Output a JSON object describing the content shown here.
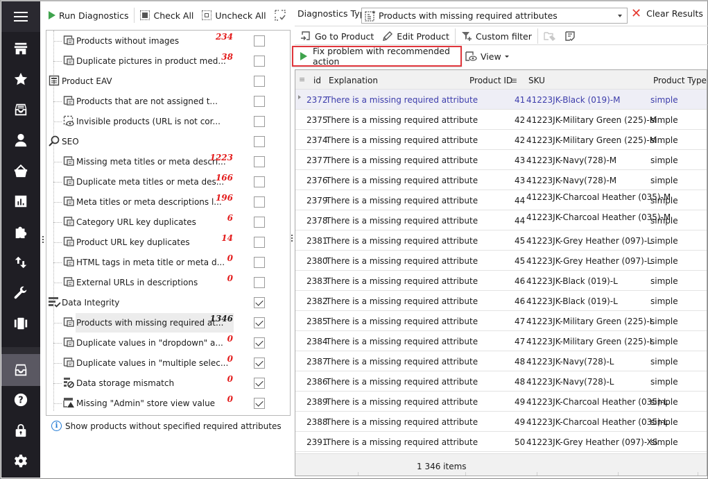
{
  "sidebar": {
    "items": [
      {
        "name": "menu",
        "icon": "hamburger-icon"
      },
      {
        "name": "store",
        "icon": "store-icon"
      },
      {
        "name": "favorites",
        "icon": "star-icon"
      },
      {
        "name": "products",
        "icon": "archive-box-icon"
      },
      {
        "name": "customers",
        "icon": "user-icon"
      },
      {
        "name": "orders",
        "icon": "basket-icon"
      },
      {
        "name": "reports",
        "icon": "bar-chart-icon"
      },
      {
        "name": "addons",
        "icon": "puzzle-icon"
      },
      {
        "name": "import-export",
        "icon": "arrows-up-down-icon"
      },
      {
        "name": "tools",
        "icon": "wrench-icon"
      },
      {
        "name": "carousel",
        "icon": "carousel-icon"
      },
      {
        "name": "store-diagnostics",
        "icon": "archive-box-icon",
        "active": true
      },
      {
        "name": "help",
        "icon": "help-icon"
      },
      {
        "name": "security",
        "icon": "lock-icon"
      },
      {
        "name": "settings",
        "icon": "gear-icon"
      }
    ]
  },
  "left_toolbar": {
    "run_diagnostics": "Run Diagnostics",
    "check_all": "Check All",
    "uncheck_all": "Uncheck All"
  },
  "tree": {
    "rows": [
      {
        "label": "Products without images",
        "count": "234",
        "checked": false,
        "level": 1,
        "icon": "no-image-icon"
      },
      {
        "label": "Duplicate pictures in product med...",
        "count": "38",
        "checked": false,
        "level": 1,
        "icon": "duplicate-image-icon"
      },
      {
        "label": "Product  EAV",
        "count": "",
        "checked": false,
        "level": 0,
        "icon": "table-icon"
      },
      {
        "label": "Products that are not assigned t...",
        "count": "",
        "checked": false,
        "level": 1,
        "icon": "unassigned-icon"
      },
      {
        "label": "Invisible products (URL is not cor...",
        "count": "",
        "checked": false,
        "level": 1,
        "icon": "invisible-icon"
      },
      {
        "label": "SEO",
        "count": "",
        "checked": false,
        "level": 0,
        "icon": "search-icon"
      },
      {
        "label": "Missing meta titles or meta descri...",
        "count": "1223",
        "checked": false,
        "level": 1,
        "icon": "missing-meta-icon"
      },
      {
        "label": "Duplicate meta titles or meta des...",
        "count": "166",
        "checked": false,
        "level": 1,
        "icon": "duplicate-meta-icon"
      },
      {
        "label": "Meta titles or meta descriptions l...",
        "count": "196",
        "checked": false,
        "level": 1,
        "icon": "meta-length-icon"
      },
      {
        "label": "Category URL key duplicates",
        "count": "6",
        "checked": false,
        "level": 1,
        "icon": "url-key-icon"
      },
      {
        "label": "Product URL key duplicates",
        "count": "14",
        "checked": false,
        "level": 1,
        "icon": "url-key-icon"
      },
      {
        "label": "HTML tags in meta title or meta d...",
        "count": "0",
        "checked": false,
        "level": 1,
        "icon": "html-tags-icon"
      },
      {
        "label": "External URLs in descriptions",
        "count": "0",
        "checked": false,
        "level": 1,
        "icon": "external-url-icon"
      },
      {
        "label": "Data Integrity",
        "count": "",
        "checked": true,
        "level": 0,
        "icon": "data-integrity-icon"
      },
      {
        "label": "Products with missing required at...",
        "count": "1346",
        "checked": true,
        "level": 1,
        "icon": "required-attr-icon",
        "selected": true
      },
      {
        "label": "Duplicate values in \"dropdown\" a...",
        "count": "0",
        "checked": true,
        "level": 1,
        "icon": "dropdown-dup-icon"
      },
      {
        "label": "Duplicate values in \"multiple selec...",
        "count": "0",
        "checked": true,
        "level": 1,
        "icon": "multiselect-dup-icon"
      },
      {
        "label": "Data storage mismatch",
        "count": "0",
        "checked": true,
        "level": 1,
        "icon": "storage-mismatch-icon"
      },
      {
        "label": "Missing \"Admin\" store view value",
        "count": "0",
        "checked": true,
        "level": 1,
        "icon": "warning-store-icon"
      }
    ]
  },
  "hint": "Show products without specified required attributes",
  "right_toolbar": {
    "diagnostics_type_label": "Diagnostics Type",
    "diagnostics_type_value": "Products with missing required attributes",
    "clear_results": "Clear Results",
    "go_to_product": "Go to Product",
    "edit_product": "Edit Product",
    "custom_filter": "Custom filter",
    "fix_problem": "Fix problem with recommended action",
    "view": "View"
  },
  "grid": {
    "columns": [
      "id",
      "Explanation",
      "Product ID",
      "SKU",
      "Product Type"
    ],
    "rows": [
      {
        "id": "2372",
        "explanation": "There is a missing required attribute",
        "product_id": "41",
        "sku": "41223JK-Black (019)-M",
        "type": "simple",
        "focused": true
      },
      {
        "id": "2375",
        "explanation": "There is a missing required attribute",
        "product_id": "42",
        "sku": "41223JK-Military Green (225)-M",
        "type": "simple"
      },
      {
        "id": "2374",
        "explanation": "There is a missing required attribute",
        "product_id": "42",
        "sku": "41223JK-Military Green (225)-M",
        "type": "simple"
      },
      {
        "id": "2377",
        "explanation": "There is a missing required attribute",
        "product_id": "43",
        "sku": "41223JK-Navy(728)-M",
        "type": "simple"
      },
      {
        "id": "2376",
        "explanation": "There is a missing required attribute",
        "product_id": "43",
        "sku": "41223JK-Navy(728)-M",
        "type": "simple"
      },
      {
        "id": "2379",
        "explanation": "There is a missing required attribute",
        "product_id": "44",
        "sku": "41223JK-Charcoal Heather (035)-M",
        "type": "simple",
        "wrap": true
      },
      {
        "id": "2378",
        "explanation": "There is a missing required attribute",
        "product_id": "44",
        "sku": "41223JK-Charcoal Heather (035)-M",
        "type": "simple",
        "wrap": true
      },
      {
        "id": "2381",
        "explanation": "There is a missing required attribute",
        "product_id": "45",
        "sku": "41223JK-Grey Heather (097)-L",
        "type": "simple"
      },
      {
        "id": "2380",
        "explanation": "There is a missing required attribute",
        "product_id": "45",
        "sku": "41223JK-Grey Heather (097)-L",
        "type": "simple"
      },
      {
        "id": "2383",
        "explanation": "There is a missing required attribute",
        "product_id": "46",
        "sku": "41223JK-Black (019)-L",
        "type": "simple"
      },
      {
        "id": "2382",
        "explanation": "There is a missing required attribute",
        "product_id": "46",
        "sku": "41223JK-Black (019)-L",
        "type": "simple"
      },
      {
        "id": "2385",
        "explanation": "There is a missing required attribute",
        "product_id": "47",
        "sku": "41223JK-Military Green (225)-L",
        "type": "simple"
      },
      {
        "id": "2384",
        "explanation": "There is a missing required attribute",
        "product_id": "47",
        "sku": "41223JK-Military Green (225)-L",
        "type": "simple"
      },
      {
        "id": "2387",
        "explanation": "There is a missing required attribute",
        "product_id": "48",
        "sku": "41223JK-Navy(728)-L",
        "type": "simple"
      },
      {
        "id": "2386",
        "explanation": "There is a missing required attribute",
        "product_id": "48",
        "sku": "41223JK-Navy(728)-L",
        "type": "simple"
      },
      {
        "id": "2389",
        "explanation": "There is a missing required attribute",
        "product_id": "49",
        "sku": "41223JK-Charcoal Heather (035)-L",
        "type": "simple"
      },
      {
        "id": "2388",
        "explanation": "There is a missing required attribute",
        "product_id": "49",
        "sku": "41223JK-Charcoal Heather (035)-L",
        "type": "simple"
      },
      {
        "id": "2391",
        "explanation": "There is a missing required attribute",
        "product_id": "50",
        "sku": "41223JK-Grey Heather (097)-XS",
        "type": "simple"
      }
    ],
    "footer": "1 346 items"
  },
  "colors": {
    "sidebar_bg": "#1f1e24",
    "sidebar_active": "#5a5862",
    "count_red": "#e31b1b",
    "highlight_border": "#e0353b",
    "play_green": "#3fa34d",
    "focused_row_text": "#3c3caa",
    "clear_x": "#e5382f"
  }
}
